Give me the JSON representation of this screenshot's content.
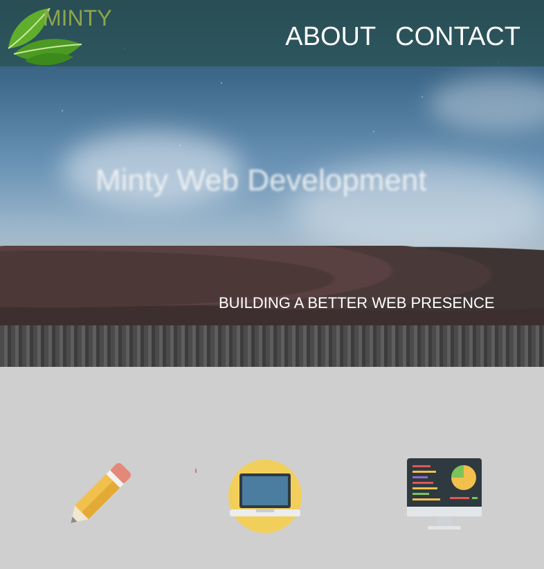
{
  "brand": {
    "name": "MINTY"
  },
  "nav": {
    "items": [
      {
        "label": "ABOUT"
      },
      {
        "label": "CONTACT"
      }
    ]
  },
  "hero": {
    "title": "Minty Web Development",
    "tagline": "BUILDING A BETTER WEB PRESENCE"
  },
  "features": [
    {
      "icon": "pencil-icon"
    },
    {
      "icon": "laptop-icon"
    },
    {
      "icon": "monitor-dashboard-icon"
    }
  ],
  "colors": {
    "header_bg": "#285050",
    "logo_text": "#8ea64a",
    "section_bg": "#cfcfcf",
    "pencil_body": "#f2c04d",
    "laptop_circle": "#f2cf5b",
    "monitor_screen": "#2f3a40"
  }
}
